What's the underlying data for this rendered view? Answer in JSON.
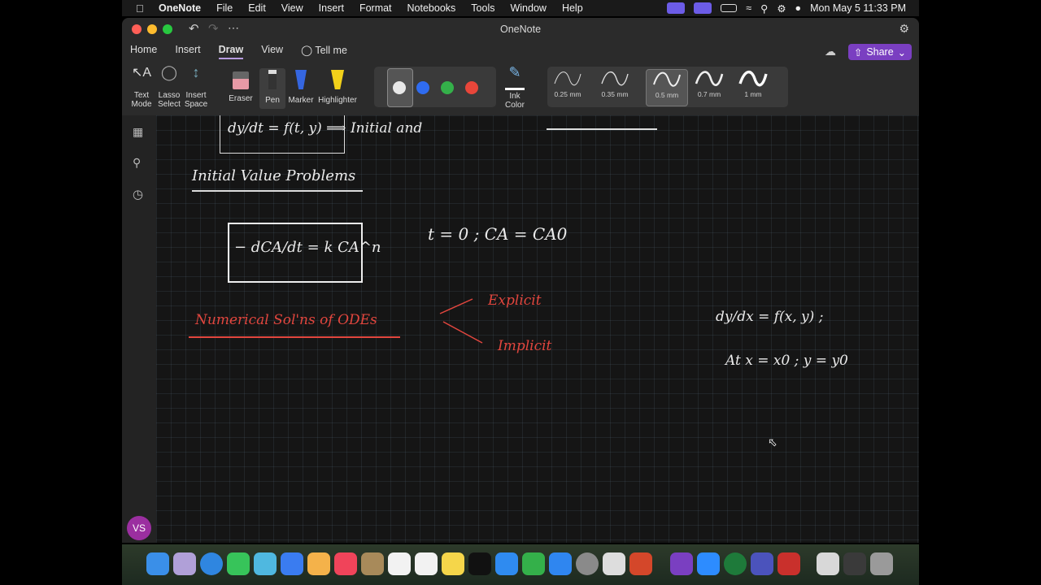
{
  "menubar": {
    "app": "OneNote",
    "items": [
      "File",
      "Edit",
      "View",
      "Insert",
      "Format",
      "Notebooks",
      "Tools",
      "Window",
      "Help"
    ],
    "clock": "Mon May 5  11:33 PM"
  },
  "window": {
    "title": "OneNote",
    "tabs": [
      "Home",
      "Insert",
      "Draw",
      "View"
    ],
    "active_tab": "Draw",
    "tell_me": "Tell me",
    "share_label": "Share"
  },
  "ribbon": {
    "text_mode": [
      "Text",
      "Mode"
    ],
    "lasso_select": [
      "Lasso",
      "Select"
    ],
    "insert_space": [
      "Insert",
      "Space"
    ],
    "eraser": "Eraser",
    "pen": "Pen",
    "marker": "Marker",
    "highlighter": "Highlighter",
    "ink_color": [
      "Ink",
      "Color"
    ],
    "thicknesses": [
      "0.25 mm",
      "0.35 mm",
      "0.5 mm",
      "0.7 mm",
      "1 mm"
    ],
    "selected_thickness": "0.5 mm",
    "colors": [
      "#e8e8e8",
      "#2f6cf0",
      "#34b04a",
      "#e8463a"
    ]
  },
  "user": {
    "initials": "VS"
  },
  "notes": {
    "eq1": "dy/dt = f(t, y)  ⟹  Initial  and",
    "ivp_heading": "Initial Value Problems",
    "rate_eq": "− dCA/dt = k CA^n",
    "init_cond": "t = 0 ;  CA = CA0",
    "numerical": "Numerical Sol'ns of ODEs",
    "explicit": "Explicit",
    "implicit": "Implicit",
    "ode_general": "dy/dx = f(x, y) ;",
    "at_cond": "At  x = x0 ;  y = y0"
  },
  "colors": {
    "ink_red": "#e2463e",
    "ink_white": "#ebebeb",
    "accent": "#7a3fc1"
  }
}
